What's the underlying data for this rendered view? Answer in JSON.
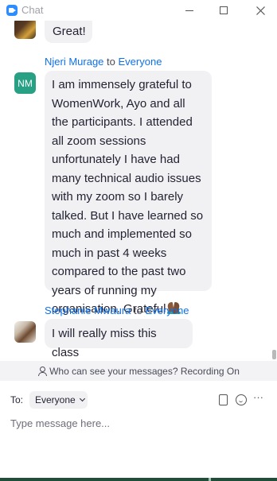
{
  "window": {
    "title": "Chat"
  },
  "messages": [
    {
      "text": "Great!"
    },
    {
      "sender": "Njeri Murage",
      "to_word": "to",
      "target": "Everyone",
      "initials": "NM",
      "text": "I am immensely grateful to WomenWork, Ayo and all the participants. I attended all zoom sessions unfortunately I have had many technical audio issues with my zoom so I barely talked.  But I have learned so much and implemented so much in past 4 weeks compared to the past two years of running my organisation. Grateful"
    },
    {
      "sender": "Stephanie Mwaura",
      "to_word": "to",
      "target": "Everyone",
      "text": "I will really miss this class"
    }
  ],
  "privacy_notice": "Who can see your messages? Recording On",
  "composer": {
    "to_label": "To:",
    "recipient": "Everyone",
    "placeholder": "Type message here...",
    "more_label": "···"
  },
  "colors": {
    "accent": "#0e71eb",
    "avatar_initials_bg": "#27a084",
    "bubble_bg": "#f1f1f4"
  },
  "icons": [
    "zoom-app-icon",
    "minimize-icon",
    "maximize-icon",
    "close-icon",
    "person-icon",
    "chevron-down-icon",
    "file-icon",
    "emoji-icon",
    "more-icon",
    "folded-hands-emoji"
  ]
}
